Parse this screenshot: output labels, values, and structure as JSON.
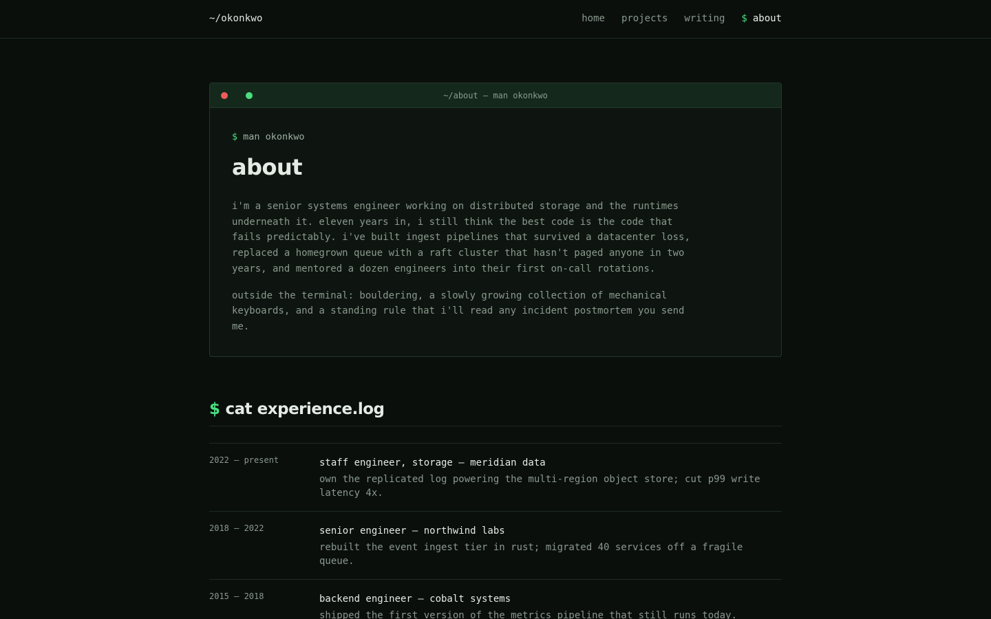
{
  "header": {
    "brand": "~/okonkwo",
    "nav": [
      {
        "label": "home"
      },
      {
        "label": "projects"
      },
      {
        "label": "writing"
      },
      {
        "label": "about",
        "prompt": "$"
      }
    ]
  },
  "terminal": {
    "title": "~/about — man okonkwo",
    "prompt": "$",
    "command": "man okonkwo",
    "heading": "about",
    "paragraphs": [
      "i'm a senior systems engineer working on distributed storage and the runtimes underneath it. eleven years in, i still think the best code is the code that fails predictably. i've built ingest pipelines that survived a datacenter loss, replaced a homegrown queue with a raft cluster that hasn't paged anyone in two years, and mentored a dozen engineers into their first on-call rotations.",
      "outside the terminal: bouldering, a slowly growing collection of mechanical keyboards, and a standing rule that i'll read any incident postmortem you send me."
    ]
  },
  "experience": {
    "prompt": "$",
    "heading": "cat experience.log",
    "entries": [
      {
        "date": "2022 — present",
        "role": "staff engineer, storage — meridian data",
        "desc": "own the replicated log powering the multi-region object store; cut p99 write latency 4x."
      },
      {
        "date": "2018 — 2022",
        "role": "senior engineer — northwind labs",
        "desc": "rebuilt the event ingest tier in rust; migrated 40 services off a fragile queue."
      },
      {
        "date": "2015 — 2018",
        "role": "backend engineer — cobalt systems",
        "desc": "shipped the first version of the metrics pipeline that still runs today."
      }
    ]
  },
  "colors": {
    "background": "#0a0f0c",
    "accent": "#4ade80",
    "close_dot": "#ef5b5b"
  }
}
